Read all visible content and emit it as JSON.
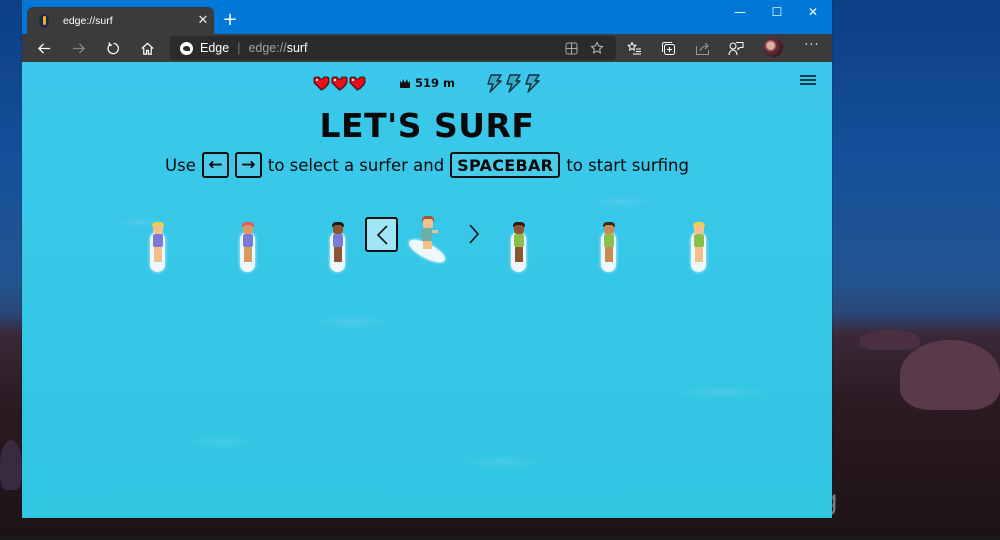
{
  "browser": {
    "tab": {
      "title": "edge://surf",
      "favicon": "surfboard-icon",
      "close_icon": "✕"
    },
    "new_tab_icon": "+",
    "window_controls": {
      "minimize": "—",
      "maximize": "☐",
      "close": "✕"
    },
    "nav": {
      "back": "back-arrow-icon",
      "forward": "forward-arrow-icon",
      "refresh": "refresh-icon",
      "home": "home-icon"
    },
    "address_bar": {
      "site_name": "Edge",
      "separator": "|",
      "url_host": "edge://",
      "url_path": "surf"
    },
    "omnibox_icons": [
      "immersive-reader-icon",
      "favorite-star-icon"
    ],
    "toolbar_icons": [
      "favorites-list-icon",
      "collections-icon",
      "share-icon",
      "feedback-icon"
    ],
    "more_label": "···"
  },
  "game": {
    "hud": {
      "lives": 3,
      "lives_icon": "heart-icon",
      "best_distance": "519 m",
      "best_icon": "crown-icon",
      "boosts": 3,
      "boost_icon": "lightning-bolt-icon"
    },
    "menu_icon": "hamburger-menu-icon",
    "title": "LET'S SURF",
    "instructions": {
      "use": "Use",
      "left_key": "←",
      "right_key": "→",
      "middle": "to select a surfer and",
      "space_key": "SPACEBAR",
      "end": "to start surfing"
    },
    "surfer_selection": {
      "prev_label": "‹",
      "next_label": "›",
      "selected_index": 3,
      "surfers": [
        {
          "name": "surfer-blonde-woman",
          "hair": "#f2d23a",
          "skin": "#f2c08a",
          "suit": "#7a7ad8",
          "legs": "#f2c08a"
        },
        {
          "name": "surfer-redhead-woman",
          "hair": "#e8566a",
          "skin": "#d99a60",
          "suit": "#7a7ad8",
          "legs": "#d99a60"
        },
        {
          "name": "surfer-dark-hair-woman",
          "hair": "#1a1a1a",
          "skin": "#8a5530",
          "suit": "#7a7ad8",
          "legs": "#8a5530"
        },
        {
          "name": "surfer-brown-hair-selected",
          "hair": "#9a5a30",
          "skin": "#f2c08a",
          "suit": "#6ab0a8",
          "legs": "#f2c08a"
        },
        {
          "name": "surfer-dark-man",
          "hair": "#2a1a10",
          "skin": "#8a5530",
          "suit": "#8ac04a",
          "legs": "#8a5530"
        },
        {
          "name": "surfer-brown-man",
          "hair": "#3a2a18",
          "skin": "#c88a50",
          "suit": "#8ac04a",
          "legs": "#c88a50"
        },
        {
          "name": "surfer-blonde-man",
          "hair": "#f2d23a",
          "skin": "#f2c08a",
          "suit": "#8ac04a",
          "legs": "#f2c08a"
        }
      ]
    }
  },
  "desktop": {
    "watermark": "ing"
  }
}
